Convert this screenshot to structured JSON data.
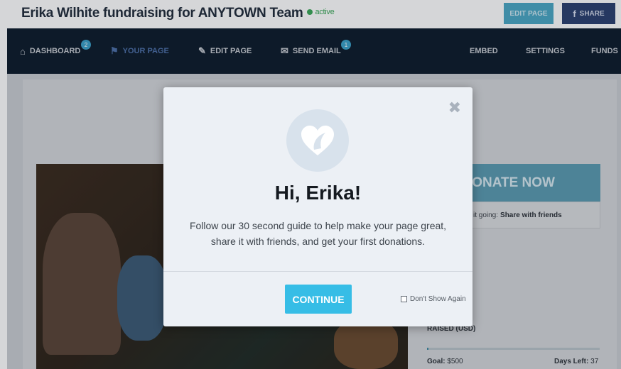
{
  "header": {
    "title": "Erika Wilhite fundraising for ANYTOWN Team",
    "status": "active",
    "edit_page_label": "EDIT PAGE",
    "share_label": "SHARE"
  },
  "nav": {
    "items": [
      {
        "label": "DASHBOARD",
        "icon": "home-icon",
        "badge": "2"
      },
      {
        "label": "YOUR PAGE",
        "icon": "flag-icon"
      },
      {
        "label": "EDIT PAGE",
        "icon": "pencil-icon"
      },
      {
        "label": "SEND EMAIL",
        "icon": "envelope-icon",
        "badge": "1"
      },
      {
        "label": "EMBED"
      },
      {
        "label": "SETTINGS"
      },
      {
        "label": "FUNDS"
      }
    ]
  },
  "sidebar": {
    "donate_label": "DONATE NOW",
    "share_prefix": "it going:",
    "share_link": "Share with friends",
    "raised_label": "RAISED (USD)",
    "progress_fraction": 0.01,
    "goal_label": "Goal:",
    "goal_value": "$500",
    "days_label": "Days Left:",
    "days_value": "37"
  },
  "modal": {
    "title": "Hi, Erika!",
    "body": "Follow our 30 second guide to help make your page great, share it with friends, and get your first donations.",
    "continue_label": "CONTINUE",
    "dont_show_label": "Don't Show Again"
  },
  "colors": {
    "accent": "#36bde6",
    "nav_bg": "#0b1a2a",
    "active_nav": "#4c6fa8",
    "status_green": "#3aa757"
  }
}
